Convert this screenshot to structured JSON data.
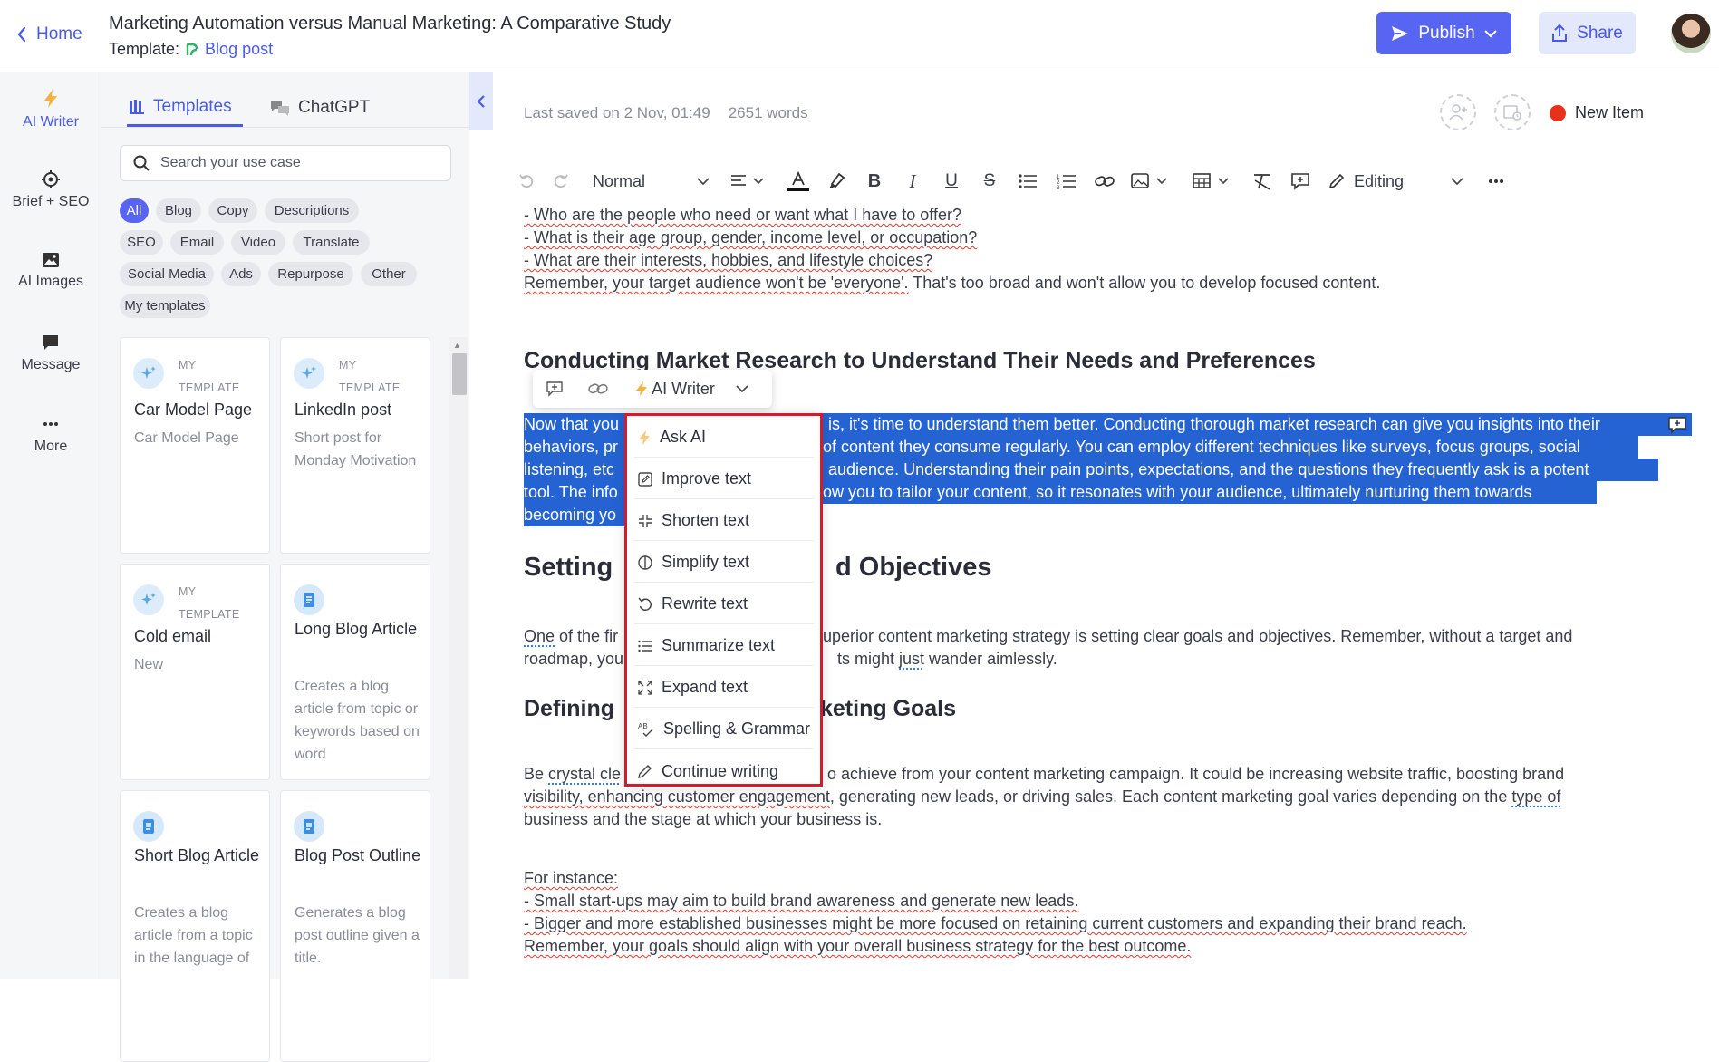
{
  "header": {
    "home_label": "Home",
    "title": "Marketing Automation versus Manual Marketing: A Comparative Study",
    "template_prefix": "Template:",
    "template_name": "Blog post",
    "publish_label": "Publish",
    "share_label": "Share"
  },
  "rail": {
    "items": [
      {
        "label": "AI Writer",
        "icon": "lightning-icon"
      },
      {
        "label": "Brief + SEO",
        "icon": "crosshair-icon"
      },
      {
        "label": "AI Images",
        "icon": "image-icon"
      },
      {
        "label": "Message",
        "icon": "message-icon"
      },
      {
        "label": "More",
        "icon": "more-dots-icon"
      }
    ]
  },
  "panel": {
    "tabs": [
      {
        "label": "Templates"
      },
      {
        "label": "ChatGPT"
      }
    ],
    "search_placeholder": "Search your use case",
    "chips": [
      "All",
      "Blog",
      "Copy",
      "Descriptions",
      "SEO",
      "Email",
      "Video",
      "Translate",
      "Social Media",
      "Ads",
      "Repurpose",
      "Other",
      "My templates"
    ],
    "my_line1": "MY",
    "my_line2": "TEMPLATE",
    "cards": [
      {
        "title": "Car Model Page",
        "desc": "Car Model Page"
      },
      {
        "title": "LinkedIn post",
        "desc": "Short post for Monday Motivation"
      },
      {
        "title": "Cold email",
        "desc": "New"
      },
      {
        "title": "Long Blog Article",
        "desc": "Creates a blog article from topic or keywords based on word"
      },
      {
        "title": "Short Blog Article",
        "desc": "Creates a blog article from a topic in the language of"
      },
      {
        "title": "Blog Post Outline",
        "desc": "Generates a blog post outline given a title."
      }
    ]
  },
  "editor": {
    "last_saved": "Last saved on 2 Nov, 01:49",
    "word_count": "2651 words",
    "new_item_label": "New Item",
    "new_item_color": "#e8311a",
    "toolbar": {
      "style_value": "Normal",
      "mode_value": "Editing"
    },
    "lines": {
      "q1": "- Who are the people who need or want what I have to offer?",
      "q2": "- What is their age group, gender, income level, or occupation?",
      "q3": "- What are their interests, hobbies, and lifestyle choices?",
      "r1a": "Remember, your target audience won't be 'everyone'.",
      "r1b": " That's too broad and won't allow you to develop focused content.",
      "h_research": "Conducting Market Research to Understand Their Needs and Preferences",
      "sel1a": "Now that you",
      "sel1b": "is, it's time to understand them better. Conducting thorough market research can give you insights into their",
      "sel2a": "behaviors, pr",
      "sel2b": "of content they consume regularly. You can employ different techniques like surveys, focus groups, social",
      "sel3a": "listening, etc",
      "sel3b": " audience. Understanding their pain points, expectations, and the questions they frequently ask is a potent",
      "sel4a": "tool. The info",
      "sel4b": "ow you to tailor your content, so it resonates with your audience, ultimately nurturing them towards",
      "sel5a": "becoming yo",
      "h_setting_a": "Setting",
      "h_setting_b": "d Objectives",
      "p1a_one": "One",
      "p1a_rest": " of the fir",
      "p1b": "uperior content marketing strategy is setting clear goals and objectives. Remember, without a target and",
      "p2a": "roadmap, you",
      "p2b": "ts might ",
      "p2c": "just",
      "p2d": " wander aimlessly.",
      "h_defining_a": "Defining",
      "h_defining_b": "keting Goals",
      "p3a": "Be ",
      "p3b": "crystal cle",
      "p3c": "o achieve from your content marketing campaign. It could be increasing website traffic, boosting brand",
      "p4a": "visibility, enhancing customer engagement",
      "p4b": ", generating new leads, or driving sales. Each content marketing goal varies depending on the ",
      "p4c": "type of",
      "p5": "business and the stage at which your business is.",
      "f1": "For instance:",
      "f2": "- Small start-ups may aim to build brand awareness and generate new leads.",
      "f3": "- Bigger and more established businesses might be more focused on retaining current customers and expanding their brand reach.",
      "f4": "Remember, your goals should align with your overall business strategy for the best outcome."
    }
  },
  "float_toolbar": {
    "ai_writer_label": "AI Writer"
  },
  "ai_menu": {
    "highlight_color": "#d61a29",
    "items": [
      {
        "label": "Ask AI",
        "icon": "lightning-icon"
      },
      {
        "label": "Improve text",
        "icon": "edit-square-icon"
      },
      {
        "label": "Shorten text",
        "icon": "shrink-icon"
      },
      {
        "label": "Simplify text",
        "icon": "half-circle-icon"
      },
      {
        "label": "Rewrite text",
        "icon": "rotate-icon"
      },
      {
        "label": "Summarize text",
        "icon": "list-icon"
      },
      {
        "label": "Expand text",
        "icon": "expand-icon"
      },
      {
        "label": "Spelling & Grammar",
        "icon": "spellcheck-icon"
      },
      {
        "label": "Continue writing",
        "icon": "pencil-icon"
      }
    ]
  }
}
